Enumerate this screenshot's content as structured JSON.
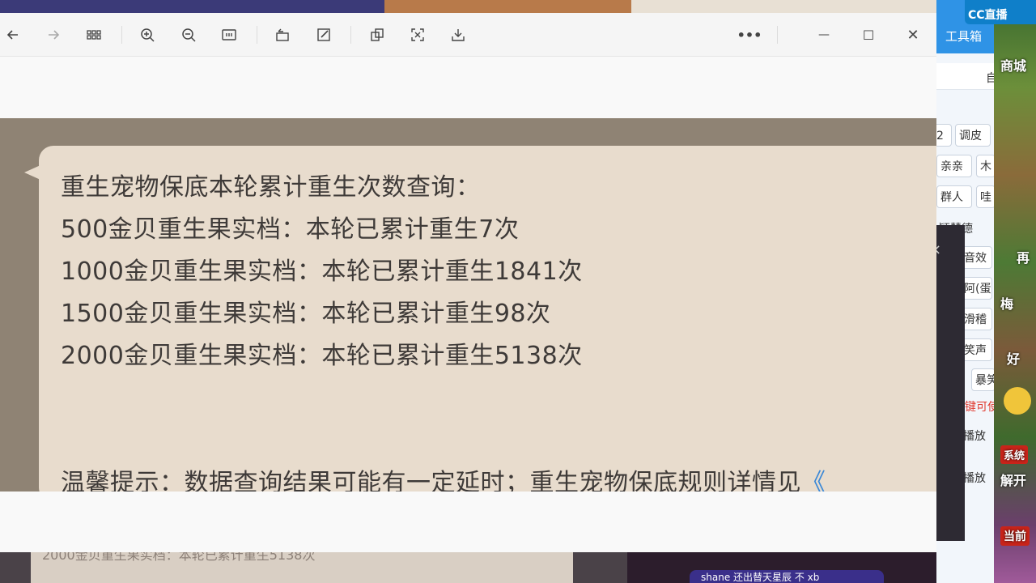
{
  "viewer": {
    "toolbar": {
      "back": "back-arrow-icon",
      "forward": "forward-arrow-icon",
      "grid": "grid-icon",
      "zoom_in": "zoom-in-icon",
      "zoom_out": "zoom-out-icon",
      "actual_size": "actual-size-icon",
      "rotate": "rotate-icon",
      "edit": "edit-icon",
      "copy": "copy-icon",
      "crop": "crop-icon",
      "download": "download-icon",
      "more": "•••",
      "minimize": "—",
      "maximize": "☐",
      "close": "✕"
    },
    "image": {
      "lines": [
        "重生宠物保底本轮累计重生次数查询：",
        "500金贝重生果实档：本轮已累计重生7次",
        "1000金贝重生果实档：本轮已累计重生1841次",
        "1500金贝重生果实档：本轮已累计重生98次",
        "2000金贝重生果实档：本轮已累计重生5138次"
      ],
      "tip": "温馨提示：数据查询结果可能有一定延时；重生宠物保底规则详情见",
      "tip_link": "《"
    }
  },
  "background": {
    "below_text": "2000金贝重生果实档：本轮已累计重生5138次",
    "chat_pill": "shane  还出替天星辰  不  xb"
  },
  "side_panel": {
    "title": "工具箱",
    "search_text": "自",
    "tags": [
      "2",
      "调皮",
      "亲亲",
      "木",
      "群人",
      "哇",
      "音效",
      "阿(蛋",
      "滑稽",
      "笑声",
      "暴笑"
    ],
    "rows": [
      "颖慧德",
      "键可使",
      "播放",
      "播放"
    ]
  },
  "game": {
    "logo": "CC直播",
    "badges": [
      "商城",
      "再",
      "梅",
      "好",
      "系统",
      "解开",
      "当前"
    ]
  },
  "colors": {
    "link": "#3b88d6",
    "bubble": "#e8dccd",
    "image_bg": "#8f8374",
    "side_header": "#2f93e6"
  }
}
